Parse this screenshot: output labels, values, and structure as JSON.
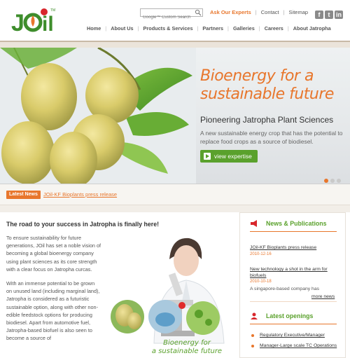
{
  "header": {
    "logo_text": "JOil",
    "search_placeholder": "Google™ Custom Search",
    "top_links": {
      "ask_expert": "Ask Our Experts",
      "contact": "Contact",
      "sitemap": "Sitemap"
    },
    "social": [
      "facebook-icon",
      "twitter-icon",
      "linkedin-icon"
    ],
    "nav": [
      "Home",
      "About Us",
      "Products & Services",
      "Partners",
      "Galleries",
      "Careers",
      "About Jatropha"
    ]
  },
  "hero": {
    "title_line1": "Bioenergy for a",
    "title_line2": "sustainable future",
    "subtitle": "Pioneering Jatropha Plant Sciences",
    "description": "A new sustainable energy crop that has the potential to replace food crops as a source of biodiesel.",
    "button_label": "view expertise",
    "slide_count": 3,
    "active_slide": 1
  },
  "latest_news": {
    "label": "Latest News",
    "headline": "JOil-KF Bioplants press release"
  },
  "main": {
    "title": "The road to your success in Jatropha is finally here!",
    "para1": "To ensure sustainability for future generations, JOil has set a noble vision of becoming a global bioenergy company using plant sciences as its core strength with a clear focus on Jatropha curcas.",
    "para2": "With an immense potential to be grown on unused land (including marginal land), Jatropha is considered as a futuristic sustainable option, along with other non-edible feedstock options for producing biodiesel. Apart from automotive fuel, Jatropha-based biofuel is also seen to become a source of",
    "caption_line1": "Bioenergy for",
    "caption_line2": "a sustainable future"
  },
  "sidebar": {
    "news_heading": "News & Publications",
    "news": [
      {
        "title": "JOil-KF Bioplants press release",
        "date": "2010-12-16"
      },
      {
        "title": "New technology a shot in the arm for biofuels",
        "date": "2010-10-18",
        "desc": "A singapore-based company has"
      }
    ],
    "more_news": "more news",
    "openings_heading": "Latest openings",
    "openings": [
      "Regulatory Executive/Manager",
      "Manager-Large scale TC Operations"
    ]
  },
  "colors": {
    "brand_orange": "#e8762c",
    "brand_green": "#5aa12c"
  }
}
